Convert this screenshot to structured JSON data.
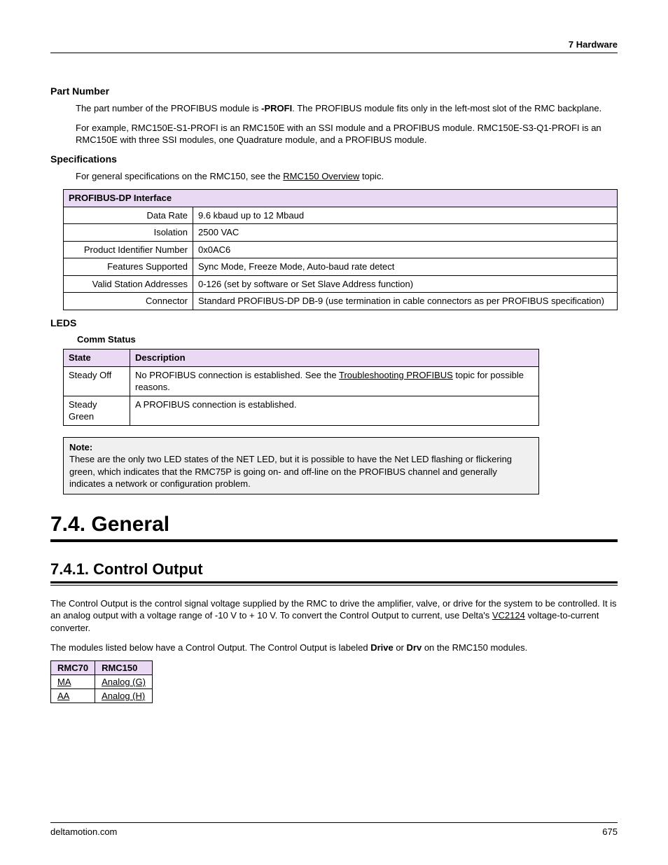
{
  "header": {
    "chapter": "7  Hardware"
  },
  "partNumber": {
    "heading": "Part Number",
    "p1a": "The part number of the PROFIBUS module is ",
    "p1b": "-PROFI",
    "p1c": ". The PROFIBUS module fits only in the left-most slot of the RMC backplane.",
    "p2": "For example, RMC150E-S1-PROFI is an RMC150E with an SSI module and a PROFIBUS module. RMC150E-S3-Q1-PROFI is an RMC150E with three SSI modules, one Quadrature module, and a PROFIBUS module."
  },
  "specs": {
    "heading": "Specifications",
    "introA": "For general specifications on the RMC150, see the ",
    "introLink": "RMC150 Overview",
    "introB": " topic.",
    "tableTitle": "PROFIBUS-DP Interface",
    "rows": [
      {
        "label": "Data Rate",
        "value": "9.6 kbaud up to 12 Mbaud"
      },
      {
        "label": "Isolation",
        "value": "2500 VAC"
      },
      {
        "label": "Product Identifier Number",
        "value": "0x0AC6"
      },
      {
        "label": "Features Supported",
        "value": "Sync Mode, Freeze Mode, Auto-baud rate detect"
      },
      {
        "label": "Valid Station Addresses",
        "value": "0-126 (set by software or Set Slave Address function)"
      },
      {
        "label": "Connector",
        "value": "Standard PROFIBUS-DP DB-9 (use termination in cable connectors as per PROFIBUS specification)"
      }
    ]
  },
  "leds": {
    "heading": "LEDS",
    "commTitle": "Comm Status",
    "headers": {
      "state": "State",
      "desc": "Description"
    },
    "rows": [
      {
        "state": "Steady Off",
        "descA": "No PROFIBUS connection is established. See the ",
        "link": "Troubleshooting PROFIBUS",
        "descB": " topic for possible reasons."
      },
      {
        "state": "Steady Green",
        "descA": "A PROFIBUS connection is established.",
        "link": "",
        "descB": ""
      }
    ],
    "noteLabel": "Note:",
    "noteBody": "These are the only two LED states of the NET LED, but it is possible to have the Net LED flashing or flickering green, which indicates that the RMC75P is going on- and off-line on the PROFIBUS channel and generally indicates a network or configuration problem."
  },
  "general": {
    "h1": "7.4. General",
    "h2": "7.4.1. Control Output",
    "p1a": "The Control Output is the control signal voltage supplied by the RMC to drive the amplifier, valve, or drive for the system to be controlled. It is an analog output with a voltage range of -10 V to + 10 V. To convert the Control Output to current, use Delta's ",
    "p1link": "VC2124",
    "p1b": " voltage-to-current converter.",
    "p2a": "The modules listed below have a Control Output. The Control Output is labeled ",
    "p2bold1": "Drive",
    "p2mid": " or ",
    "p2bold2": "Drv",
    "p2b": " on the RMC150 modules.",
    "table": {
      "headers": {
        "c1": "RMC70",
        "c2": "RMC150"
      },
      "rows": [
        {
          "c1": "MA",
          "c2": "Analog (G)"
        },
        {
          "c1": "AA",
          "c2": "Analog (H)"
        }
      ]
    }
  },
  "footer": {
    "site": "deltamotion.com",
    "page": "675"
  }
}
